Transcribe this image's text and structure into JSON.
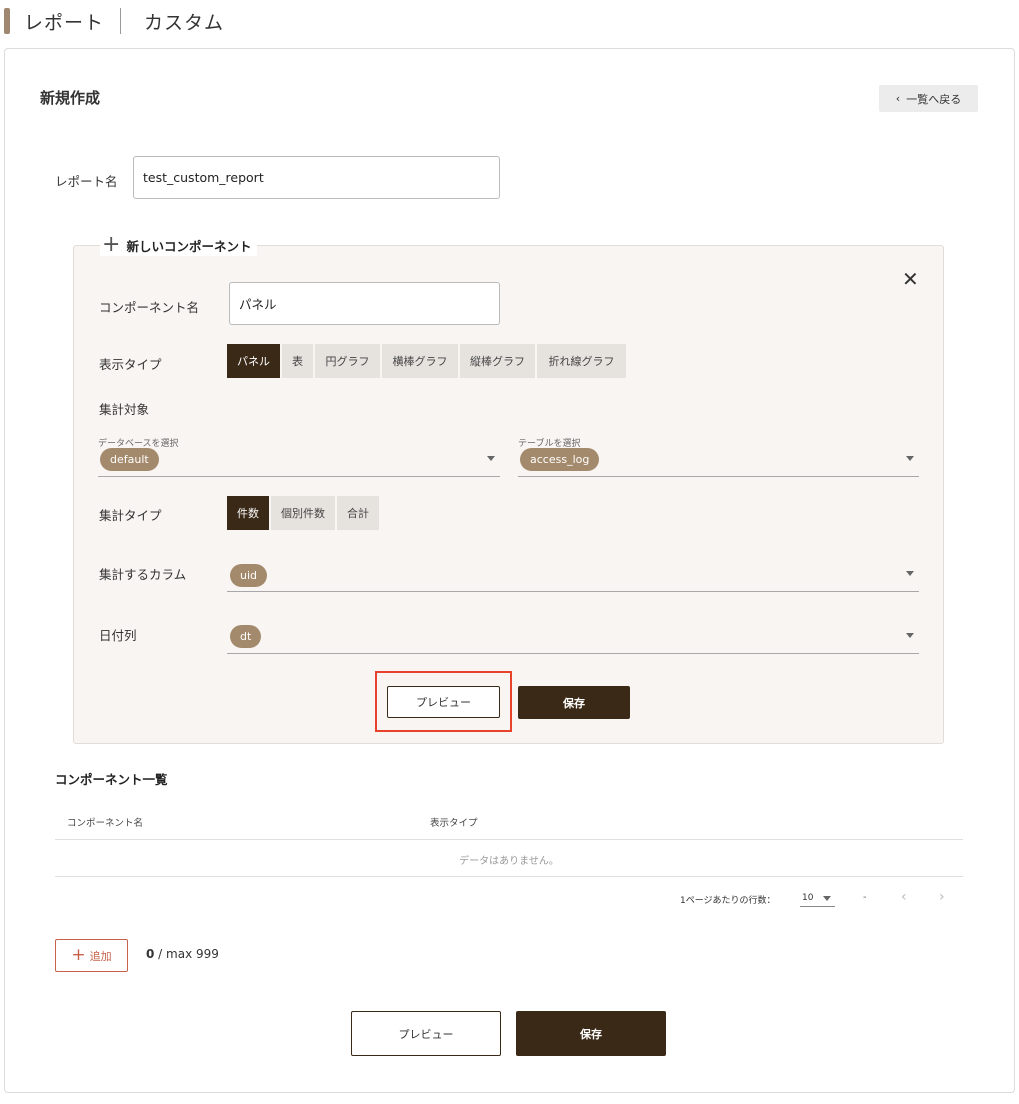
{
  "breadcrumb": {
    "root": "レポート",
    "current": "カスタム"
  },
  "page": {
    "title": "新規作成",
    "back_label": "一覧へ戻る"
  },
  "report_name": {
    "label": "レポート名",
    "value": "test_custom_report"
  },
  "component_editor": {
    "heading": "新しいコンポーネント",
    "name_label": "コンポーネント名",
    "name_value": "パネル",
    "display_type_label": "表示タイプ",
    "display_types": [
      "パネル",
      "表",
      "円グラフ",
      "横棒グラフ",
      "縦棒グラフ",
      "折れ線グラフ"
    ],
    "display_type_selected": "パネル",
    "target_label": "集計対象",
    "database_hint": "データベースを選択",
    "database_value": "default",
    "table_hint": "テーブルを選択",
    "table_value": "access_log",
    "agg_type_label": "集計タイプ",
    "agg_types": [
      "件数",
      "個別件数",
      "合計"
    ],
    "agg_type_selected": "件数",
    "agg_column_label": "集計するカラム",
    "agg_column_value": "uid",
    "date_column_label": "日付列",
    "date_column_value": "dt",
    "preview_label": "プレビュー",
    "save_label": "保存"
  },
  "component_list": {
    "title": "コンポーネント一覧",
    "columns": [
      "コンポーネント名",
      "表示タイプ"
    ],
    "empty_text": "データはありません。",
    "rows_per_page_label": "1ページあたりの行数：",
    "rows_per_page_value": "10",
    "range_text": "-"
  },
  "add": {
    "label": "追加",
    "count": "0",
    "max_text": " / max 999"
  },
  "footer": {
    "preview_label": "プレビュー",
    "save_label": "保存"
  },
  "colors": {
    "brand_dark": "#3a2916",
    "chip": "#a48a6c",
    "accent_red": "#e8412c",
    "add_red": "#c8614a"
  }
}
